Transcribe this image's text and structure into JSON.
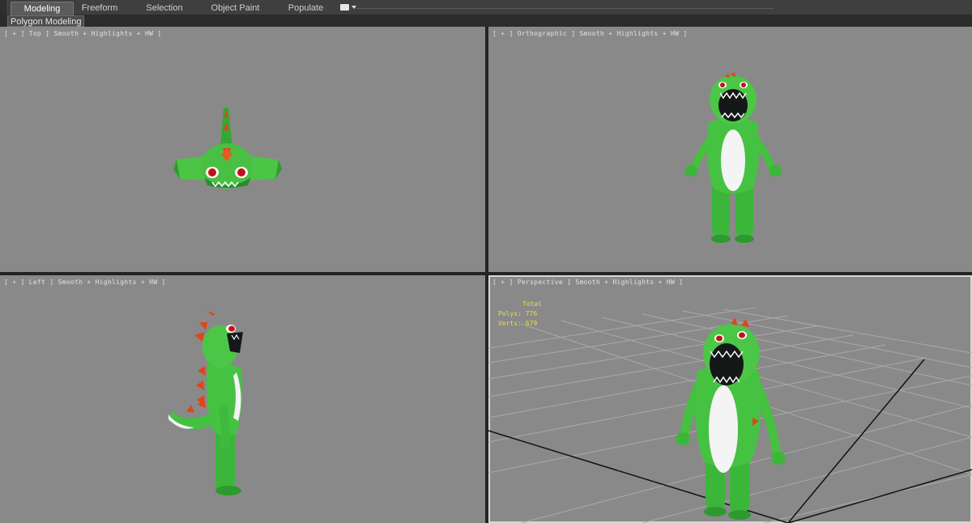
{
  "ribbon": {
    "tabs": [
      {
        "label": "Modeling",
        "active": true
      },
      {
        "label": "Freeform",
        "active": false
      },
      {
        "label": "Selection",
        "active": false
      },
      {
        "label": "Object Paint",
        "active": false
      },
      {
        "label": "Populate",
        "active": false
      }
    ],
    "panel_label": "Polygon Modeling"
  },
  "viewports": {
    "top": {
      "label": "[ + ] Top ] Smooth + Highlights + HW ]"
    },
    "ortho": {
      "label": "[ + ] Orthographic ] Smooth + Highlights + HW ]"
    },
    "left": {
      "label": "[ + ] Left ] Smooth + Highlights + HW ]"
    },
    "persp": {
      "label": "[ + ] Perspective ] Smooth + Highlights + HW ]"
    }
  },
  "stats": {
    "total_label": "Total",
    "polys": "Polys: 776",
    "verts": "Verts: 679"
  },
  "colors": {
    "viewport_bg": "#898989",
    "dino_green": "#3fbf3a",
    "dino_dark": "#279a2a",
    "belly": "#f4f4f4",
    "spike": "#e0451b",
    "stats_text": "#e8e03a"
  }
}
